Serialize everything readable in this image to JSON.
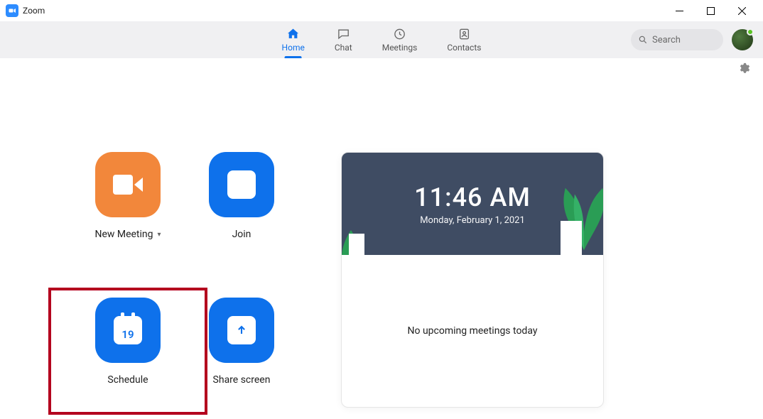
{
  "window": {
    "title": "Zoom"
  },
  "nav": {
    "items": [
      {
        "label": "Home",
        "icon": "home-icon",
        "active": true
      },
      {
        "label": "Chat",
        "icon": "chat-icon",
        "active": false
      },
      {
        "label": "Meetings",
        "icon": "clock-icon",
        "active": false
      },
      {
        "label": "Contacts",
        "icon": "contact-icon",
        "active": false
      }
    ],
    "search_placeholder": "Search"
  },
  "tiles": {
    "new_meeting": {
      "label": "New Meeting",
      "dropdown": true
    },
    "join": {
      "label": "Join"
    },
    "schedule": {
      "label": "Schedule",
      "cal_day": "19",
      "highlighted": true
    },
    "share_screen": {
      "label": "Share screen"
    }
  },
  "clock": {
    "time": "11:46 AM",
    "date": "Monday, February 1, 2021"
  },
  "meetings": {
    "empty_text": "No upcoming meetings today"
  }
}
